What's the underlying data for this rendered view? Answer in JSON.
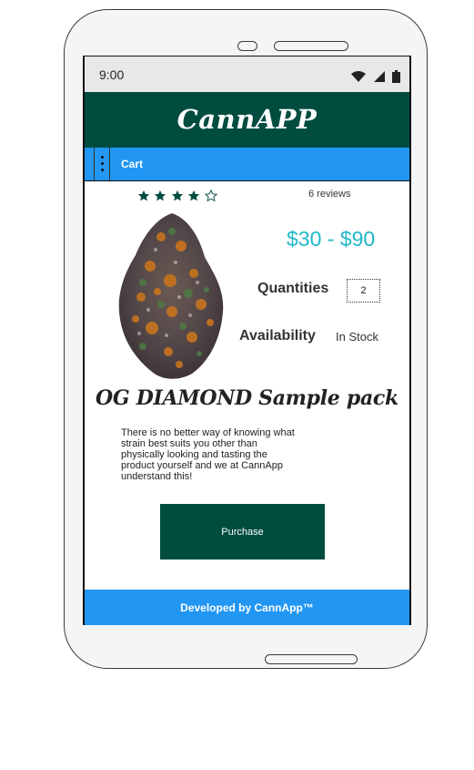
{
  "status_bar": {
    "time": "9:00"
  },
  "app": {
    "title": "CannAPP"
  },
  "nav": {
    "cart_label": "Cart"
  },
  "product": {
    "rating": 4,
    "rating_max": 5,
    "reviews_label": "6 reviews",
    "price_range": "$30 - $90",
    "quantity_label": "Quantities",
    "quantity_value": "2",
    "availability_label": "Availability",
    "availability_value": "In Stock",
    "name": "OG DIAMOND Sample pack",
    "description": "There is no better way of knowing what strain best suits you other than physically looking and tasting the product yourself and we at CannApp understand this!",
    "purchase_label": "Purchase"
  },
  "footer": {
    "text": "Developed by CannApp™"
  },
  "colors": {
    "header_bg": "#004d40",
    "nav_bg": "#2196f3",
    "price": "#1fb8c9",
    "button_bg": "#004d40"
  },
  "icons": {
    "menu": "vertical-dots-menu-icon",
    "wifi": "wifi-icon",
    "signal": "cell-signal-icon",
    "battery": "battery-icon",
    "star_filled": "star-filled-icon",
    "star_empty": "star-outline-icon"
  }
}
